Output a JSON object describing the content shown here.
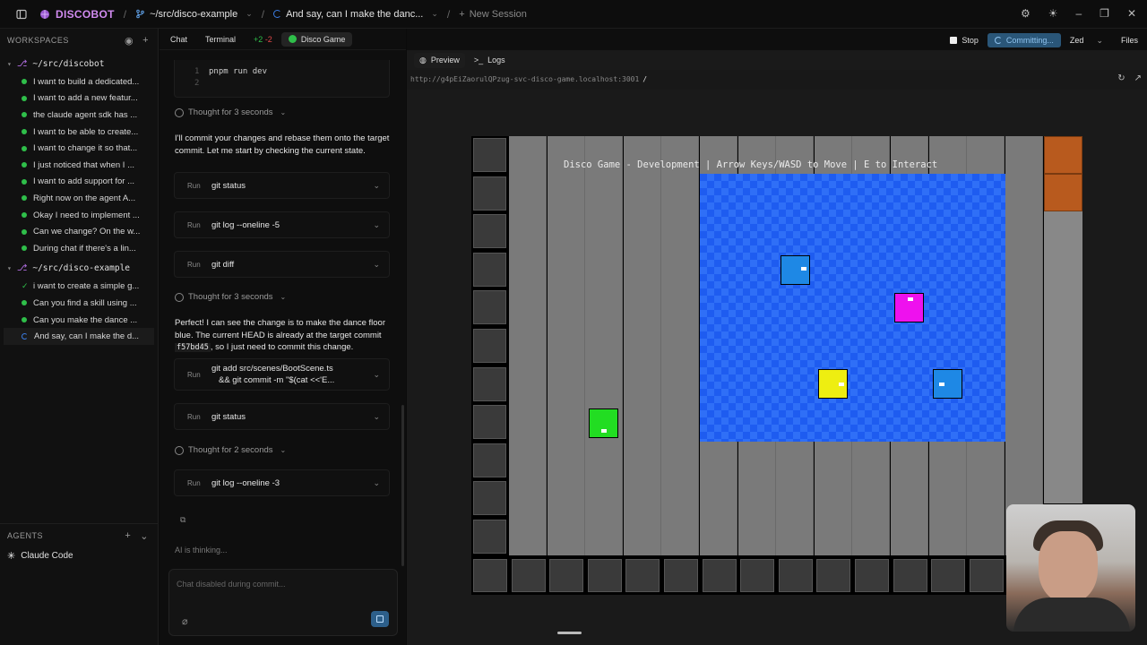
{
  "titlebar": {
    "app_name": "DISCOBOT",
    "crumb_repo": "~/src/disco-example",
    "crumb_session": "And say, can I make the danc...",
    "new_session": "New Session"
  },
  "sidebar": {
    "workspaces_label": "WORKSPACES",
    "workspaces": [
      {
        "path": "~/src/discobot",
        "sessions": [
          "I want to build a dedicated...",
          "I want to add a new featur...",
          "the claude agent sdk has ...",
          "I want to be able to create...",
          "I want to change it so that...",
          "I just noticed that when I ...",
          "I want to add support for ...",
          "Right now on the agent A...",
          "Okay I need to implement ...",
          "Can we change? On the w...",
          "During chat if there's a lin..."
        ]
      },
      {
        "path": "~/src/disco-example",
        "sessions": [
          "i want to create a simple g...",
          "Can you find a skill using ...",
          "Can you make the dance ...",
          "And say, can I make the d..."
        ]
      }
    ],
    "agents_label": "AGENTS",
    "agent_name": "Claude Code"
  },
  "chat": {
    "tabs": {
      "chat": "Chat",
      "terminal": "Terminal",
      "diff_add": "+2",
      "diff_del": "-2",
      "game": "Disco Game"
    },
    "code_lines": [
      {
        "n": "1",
        "text": "pnpm run dev"
      },
      {
        "n": "2",
        "text": ""
      }
    ],
    "thought1": "Thought for 3 seconds",
    "msg1": "I'll commit your changes and rebase them onto the target commit. Let me start by checking the current state.",
    "run_label": "Run",
    "cmd_status": "git status",
    "cmd_log5": "git log --oneline -5",
    "cmd_diff": "git diff",
    "thought2": "Thought for 3 seconds",
    "msg2_a": "Perfect! I can see the change is to make the dance floor blue. The current HEAD is already at the target commit",
    "msg2_code": "f57bd45",
    "msg2_b": ", so I just need to commit this change.",
    "cmd_add_1": "git add src/scenes/BootScene.ts",
    "cmd_add_2": "&& git commit -m \"$(cat <<'E...",
    "cmd_status2": "git status",
    "thought3": "Thought for 2 seconds",
    "cmd_log3": "git log --oneline -3",
    "thinking": "AI is thinking...",
    "composer_placeholder": "Chat disabled during commit..."
  },
  "main": {
    "stop_label": "Stop",
    "committing_label": "Committing...",
    "editor_label": "Zed",
    "files_label": "Files",
    "preview_tab": "Preview",
    "logs_tab": "Logs",
    "url": "http://g4pEiZaorulQPzug-svc-disco-game.localhost:3001",
    "url_path": "/"
  },
  "game": {
    "title": "Disco Game - Development | Arrow Keys/WASD to Move | E to Interact",
    "floor_color": "#1e5cf0",
    "sprites": [
      {
        "name": "player-green",
        "color": "#22dd22"
      },
      {
        "name": "dancer-blue-1",
        "color": "#1e88e5"
      },
      {
        "name": "dancer-magenta",
        "color": "#ee11ee"
      },
      {
        "name": "dancer-yellow",
        "color": "#eeee11"
      },
      {
        "name": "dancer-blue-2",
        "color": "#1e88e5"
      }
    ]
  }
}
